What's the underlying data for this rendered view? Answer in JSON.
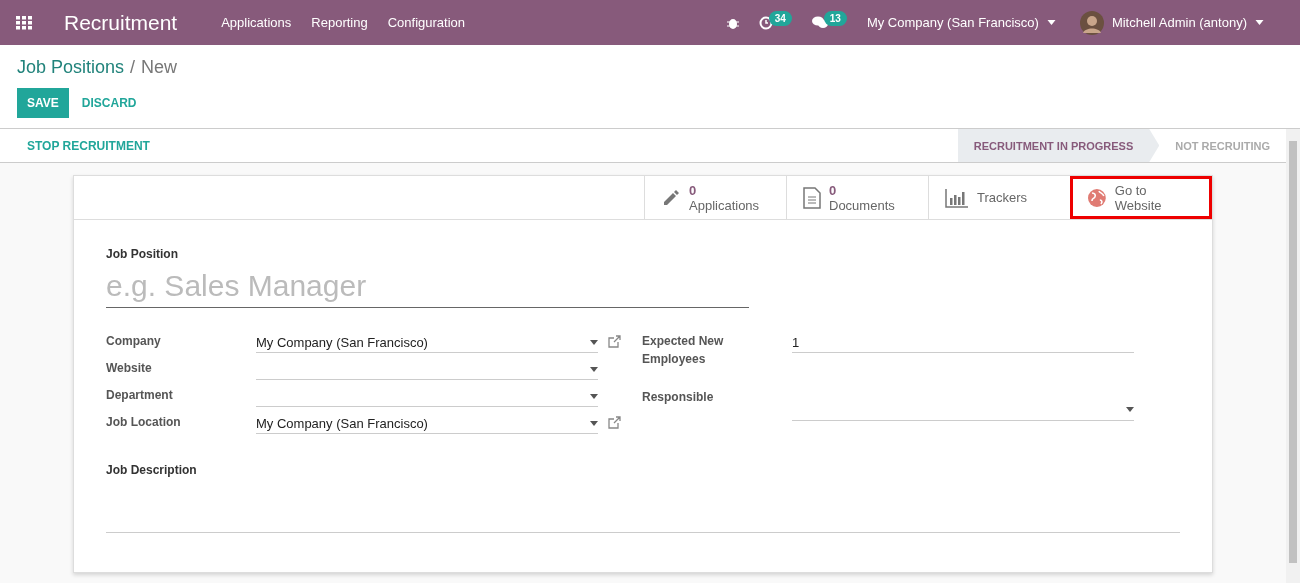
{
  "navbar": {
    "app_title": "Recruitment",
    "menu": [
      "Applications",
      "Reporting",
      "Configuration"
    ],
    "activity_count": "34",
    "message_count": "13",
    "company": "My Company (San Francisco)",
    "user": "Mitchell Admin (antony)"
  },
  "breadcrumb": {
    "parent": "Job Positions",
    "separator": "/",
    "current": "New"
  },
  "buttons": {
    "save": "SAVE",
    "discard": "DISCARD"
  },
  "header_action": "STOP RECRUITMENT",
  "stages": [
    {
      "label": "RECRUITMENT IN PROGRESS",
      "selected": true
    },
    {
      "label": "NOT RECRUITING",
      "selected": false
    }
  ],
  "stat_buttons": [
    {
      "kind": "pencil",
      "count": "0",
      "label": "Applications",
      "highlighted": false
    },
    {
      "kind": "document",
      "count": "0",
      "label": "Documents",
      "highlighted": false
    },
    {
      "kind": "chart",
      "label": "Trackers",
      "highlighted": false
    },
    {
      "kind": "globe",
      "label": "Go to Website",
      "highlighted": true
    }
  ],
  "job_position": {
    "label": "Job Position",
    "placeholder": "e.g. Sales Manager"
  },
  "left_fields": [
    {
      "kind": "linked_select",
      "label": "Company",
      "value": "My Company (San Francisco)"
    },
    {
      "kind": "select",
      "label": "Website"
    },
    {
      "kind": "select",
      "label": "Department"
    },
    {
      "kind": "linked_select",
      "label": "Job Location",
      "value": "My Company (San Francisco)"
    }
  ],
  "right_fields": [
    {
      "kind": "text",
      "label": "Expected New Employees",
      "value": "1"
    },
    {
      "kind": "select",
      "label": "Responsible"
    }
  ],
  "description_label": "Job Description"
}
